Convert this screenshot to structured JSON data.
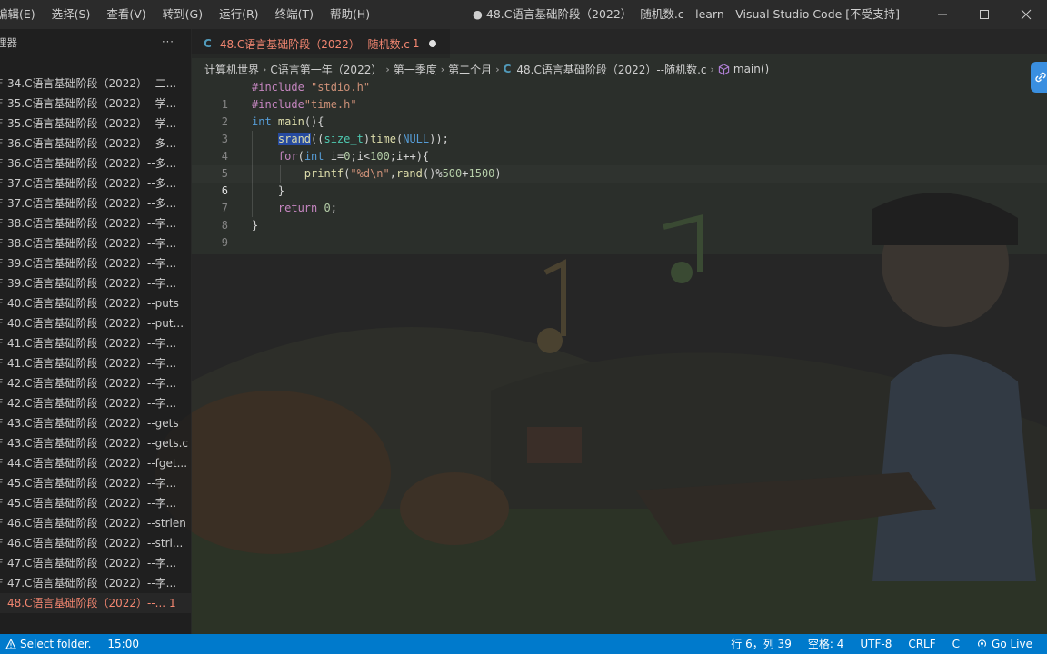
{
  "menu": [
    "编辑(E)",
    "选择(S)",
    "查看(V)",
    "转到(G)",
    "运行(R)",
    "终端(T)",
    "帮助(H)"
  ],
  "window_title": "● 48.C语言基础阶段（2022）--随机数.c - learn - Visual Studio Code [不受支持]",
  "sidebar": {
    "title": "理器",
    "more": "···",
    "files": [
      {
        "name": "34.C语言基础阶段（2022）--二...",
        "icon": "F",
        "badge": ""
      },
      {
        "name": "35.C语言基础阶段（2022）--学...",
        "icon": "F",
        "badge": ""
      },
      {
        "name": "35.C语言基础阶段（2022）--学...",
        "icon": "F",
        "badge": ""
      },
      {
        "name": "36.C语言基础阶段（2022）--多...",
        "icon": "F",
        "badge": ""
      },
      {
        "name": "36.C语言基础阶段（2022）--多...",
        "icon": "F",
        "badge": ""
      },
      {
        "name": "37.C语言基础阶段（2022）--多...",
        "icon": "F",
        "badge": ""
      },
      {
        "name": "37.C语言基础阶段（2022）--多...",
        "icon": "F",
        "badge": ""
      },
      {
        "name": "38.C语言基础阶段（2022）--字...",
        "icon": "F",
        "badge": ""
      },
      {
        "name": "38.C语言基础阶段（2022）--字...",
        "icon": "F",
        "badge": ""
      },
      {
        "name": "39.C语言基础阶段（2022）--字...",
        "icon": "F",
        "badge": ""
      },
      {
        "name": "39.C语言基础阶段（2022）--字...",
        "icon": "F",
        "badge": ""
      },
      {
        "name": "40.C语言基础阶段（2022）--puts",
        "icon": "F",
        "badge": ""
      },
      {
        "name": "40.C语言基础阶段（2022）--put...",
        "icon": "F",
        "badge": ""
      },
      {
        "name": "41.C语言基础阶段（2022）--字...",
        "icon": "F",
        "badge": ""
      },
      {
        "name": "41.C语言基础阶段（2022）--字...",
        "icon": "F",
        "badge": ""
      },
      {
        "name": "42.C语言基础阶段（2022）--字...",
        "icon": "F",
        "badge": ""
      },
      {
        "name": "42.C语言基础阶段（2022）--字...",
        "icon": "F",
        "badge": ""
      },
      {
        "name": "43.C语言基础阶段（2022）--gets",
        "icon": "F",
        "badge": ""
      },
      {
        "name": "43.C语言基础阶段（2022）--gets.c",
        "icon": "F",
        "badge": ""
      },
      {
        "name": "44.C语言基础阶段（2022）--fget...",
        "icon": "F",
        "badge": ""
      },
      {
        "name": "45.C语言基础阶段（2022）--字...",
        "icon": "F",
        "badge": ""
      },
      {
        "name": "45.C语言基础阶段（2022）--字...",
        "icon": "F",
        "badge": ""
      },
      {
        "name": "46.C语言基础阶段（2022）--strlen",
        "icon": "F",
        "badge": ""
      },
      {
        "name": "46.C语言基础阶段（2022）--strl...",
        "icon": "F",
        "badge": ""
      },
      {
        "name": "47.C语言基础阶段（2022）--字...",
        "icon": "F",
        "badge": ""
      },
      {
        "name": "47.C语言基础阶段（2022）--字...",
        "icon": "F",
        "badge": ""
      },
      {
        "name": "48.C语言基础阶段（2022）--...",
        "icon": "",
        "badge": "1",
        "active": true
      }
    ]
  },
  "tab": {
    "icon": "C",
    "label": "48.C语言基础阶段（2022）--随机数.c",
    "badge": "1"
  },
  "breadcrumbs": {
    "parts": [
      "计算机世界",
      "C语言第一年（2022）",
      "第一季度",
      "第二个月"
    ],
    "file_icon": "C",
    "file": "48.C语言基础阶段（2022）--随机数.c",
    "symbol": "main()"
  },
  "code": {
    "current_line": 6,
    "lines": [
      "#include \"stdio.h\"",
      "#include\"time.h\"",
      "int main(){",
      "    srand((size_t)time(NULL));",
      "    for(int i=0;i<100;i++){",
      "        printf(\"%d\\n\",rand()%500+1500)",
      "    }",
      "    return 0;",
      "}"
    ]
  },
  "status": {
    "select_folder": "Select folder.",
    "time": "15:00",
    "position": "行 6，列 39",
    "spaces": "空格: 4",
    "encoding": "UTF-8",
    "eol": "CRLF",
    "language": "C",
    "go_live": "Go Live"
  },
  "colors": {
    "status_bar": "#007acc",
    "error_file": "#f48771",
    "keyword": "#569cd6",
    "string": "#ce9178"
  }
}
